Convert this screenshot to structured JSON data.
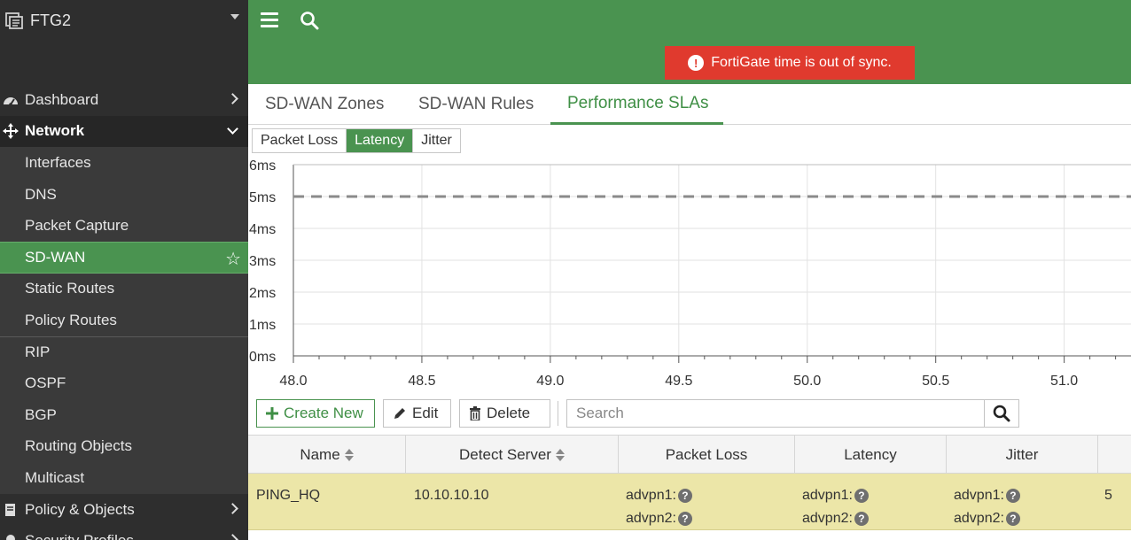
{
  "device": {
    "name": "FTG2",
    "icon": "fortigate-device-icon"
  },
  "sidebar": {
    "items": [
      {
        "label": "Dashboard",
        "icon": "dashboard-icon"
      },
      {
        "label": "Network",
        "icon": "network-move-icon"
      },
      {
        "label": "Interfaces"
      },
      {
        "label": "DNS"
      },
      {
        "label": "Packet Capture"
      },
      {
        "label": "SD-WAN"
      },
      {
        "label": "Static Routes"
      },
      {
        "label": "Policy Routes"
      },
      {
        "label": "RIP"
      },
      {
        "label": "OSPF"
      },
      {
        "label": "BGP"
      },
      {
        "label": "Routing Objects"
      },
      {
        "label": "Multicast"
      },
      {
        "label": "Policy & Objects",
        "icon": "policy-objects-icon"
      },
      {
        "label": "Security Profiles",
        "icon": "security-profiles-icon"
      }
    ]
  },
  "alert": {
    "text": "FortiGate time is out of sync."
  },
  "tabs": [
    {
      "label": "SD-WAN Zones"
    },
    {
      "label": "SD-WAN Rules"
    },
    {
      "label": "Performance SLAs",
      "active": true
    }
  ],
  "metric_toggle": {
    "options": [
      "Packet Loss",
      "Latency",
      "Jitter"
    ],
    "selected": "Latency"
  },
  "chart_data": {
    "type": "line",
    "y_ticks": [
      "6ms",
      "5ms",
      "4ms",
      "3ms",
      "2ms",
      "1ms",
      "0ms"
    ],
    "x_ticks": [
      "48.0",
      "48.5",
      "49.0",
      "49.5",
      "50.0",
      "50.5",
      "51.0"
    ],
    "xlim": [
      48.0,
      51.26
    ],
    "ylim": [
      0,
      6
    ],
    "threshold": {
      "value": 5,
      "style": "dashed"
    },
    "grid": true,
    "series": []
  },
  "toolbar": {
    "create_label": "Create New",
    "edit_label": "Edit",
    "delete_label": "Delete",
    "search_placeholder": "Search"
  },
  "table": {
    "columns": [
      "Name",
      "Detect Server",
      "Packet Loss",
      "Latency",
      "Jitter"
    ],
    "rows": [
      {
        "name": "PING_HQ",
        "detect_server": "10.10.10.10",
        "packet_loss": [
          "advpn1:",
          "advpn2:"
        ],
        "latency": [
          "advpn1:",
          "advpn2:"
        ],
        "jitter": [
          "advpn1:",
          "advpn2:"
        ],
        "extra": "5"
      }
    ]
  },
  "colors": {
    "accent": "#4a9350",
    "sidebar": "#2e2e2e",
    "alert": "#e03a2e",
    "row_highlight": "#ece6a8"
  }
}
